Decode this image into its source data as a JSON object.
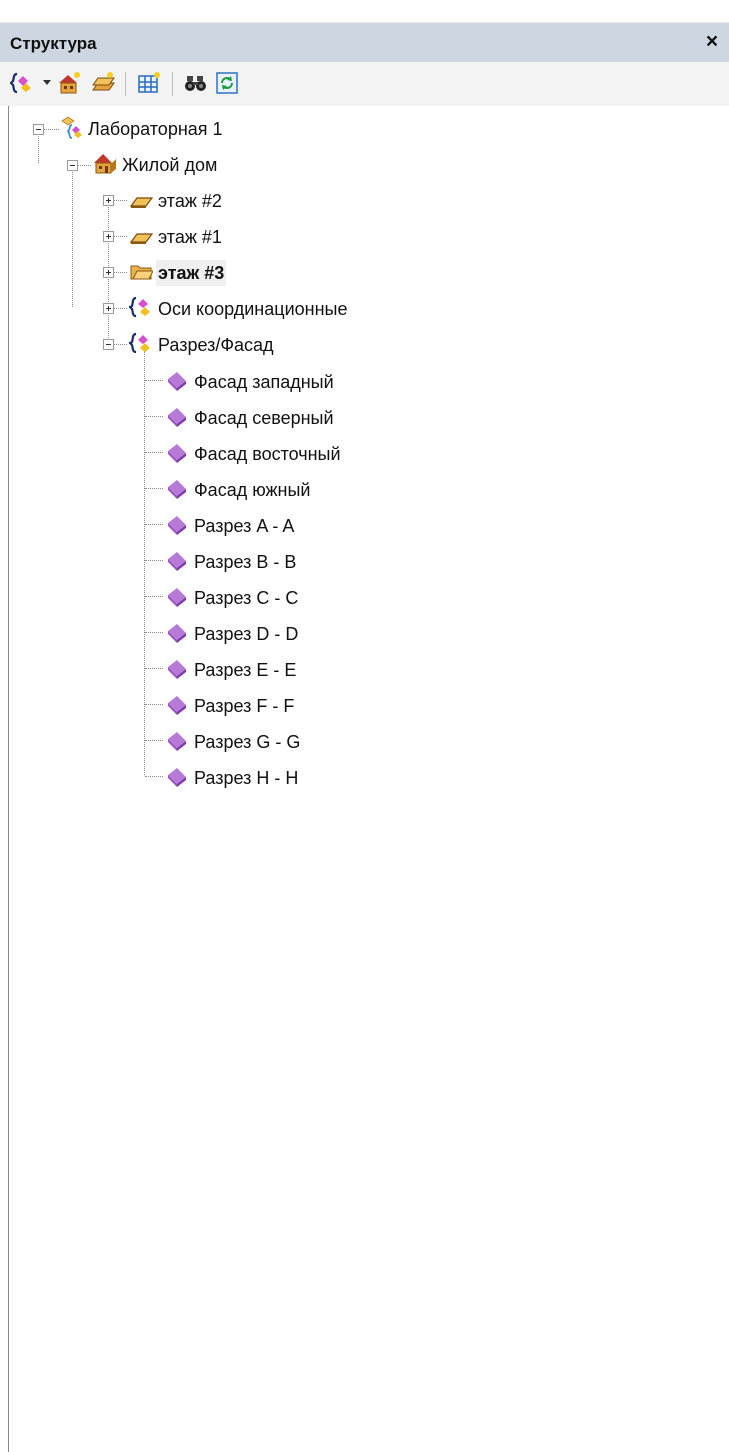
{
  "panel": {
    "title": "Структура",
    "close_glyph": "×"
  },
  "toolbar": {
    "buttons": [
      {
        "name": "structure-menu-icon",
        "dropdown": true
      },
      {
        "name": "add-building-icon"
      },
      {
        "name": "add-floor-icon"
      },
      {
        "name": "grid-icon"
      },
      {
        "name": "find-icon"
      },
      {
        "name": "refresh-icon"
      }
    ]
  },
  "tree": {
    "root": {
      "label": "Лабораторная 1",
      "icon": "project-icon",
      "expanded": true
    },
    "building": {
      "label": "Жилой дом",
      "icon": "house-icon",
      "expanded": true
    },
    "floors": [
      {
        "label": "этаж #2",
        "icon": "floor-icon",
        "bold": false,
        "expanded": false
      },
      {
        "label": "этаж #1",
        "icon": "floor-icon",
        "bold": false,
        "expanded": false
      },
      {
        "label": "этаж #3",
        "icon": "open-floor-icon",
        "bold": true,
        "expanded": false
      }
    ],
    "axes": {
      "label": "Оси координационные",
      "icon": "braces-icon",
      "expanded": false
    },
    "sections": {
      "label": "Разрез/Фасад",
      "icon": "braces-icon",
      "expanded": true
    },
    "section_items": [
      {
        "label": "Фасад западный"
      },
      {
        "label": "Фасад северный"
      },
      {
        "label": "Фасад восточный"
      },
      {
        "label": "Фасад южный"
      },
      {
        "label": "Разрез A - A"
      },
      {
        "label": "Разрез B - B"
      },
      {
        "label": "Разрез C - C"
      },
      {
        "label": "Разрез D - D"
      },
      {
        "label": "Разрез E - E"
      },
      {
        "label": "Разрез F - F"
      },
      {
        "label": "Разрез G - G"
      },
      {
        "label": "Разрез H - H"
      }
    ]
  },
  "colors": {
    "titlebar": "#cdd6e1",
    "toolbar": "#f3f3f3",
    "selected_row": "#efefef",
    "section_icon": "#b77ad6"
  }
}
